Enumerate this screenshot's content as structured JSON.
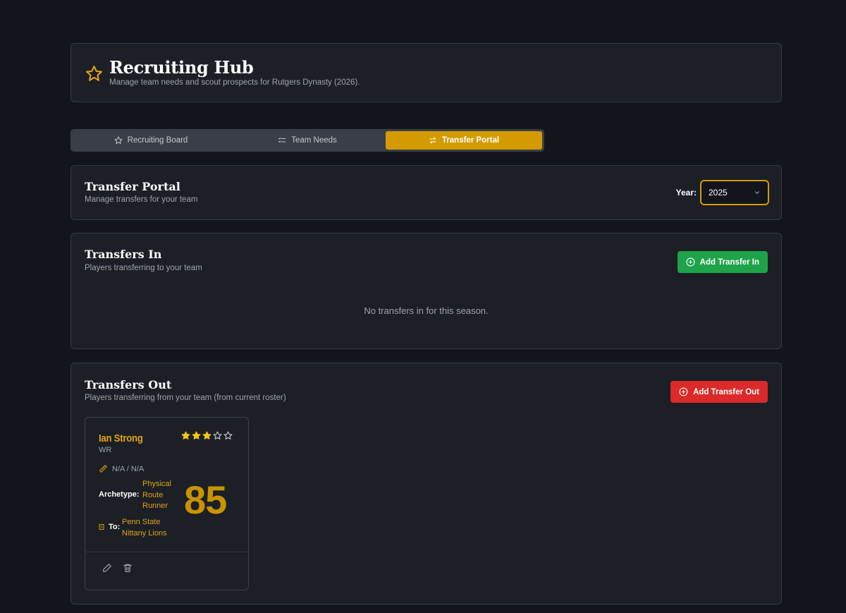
{
  "header": {
    "title": "Recruiting Hub",
    "subtitle": "Manage team needs and scout prospects for Rutgers Dynasty (2026).",
    "icon": "star-icon"
  },
  "tabs": [
    {
      "label": "Recruiting Board",
      "icon": "star-icon",
      "active": false
    },
    {
      "label": "Team Needs",
      "icon": "list-checks-icon",
      "active": false
    },
    {
      "label": "Transfer Portal",
      "icon": "arrows-swap-icon",
      "active": true
    }
  ],
  "portal": {
    "title": "Transfer Portal",
    "subtitle": "Manage transfers for your team",
    "year_label": "Year:",
    "year_value": "2025"
  },
  "transfers_in": {
    "title": "Transfers In",
    "subtitle": "Players transferring to your team",
    "add_label": "Add Transfer In",
    "empty_text": "No transfers in for this season."
  },
  "transfers_out": {
    "title": "Transfers Out",
    "subtitle": "Players transferring from your team (from current roster)",
    "add_label": "Add Transfer Out",
    "players": [
      {
        "name": "Ian Strong",
        "position": "WR",
        "stars": 3,
        "max_stars": 5,
        "height_weight": "N/A / N/A",
        "archetype_label": "Archetype:",
        "archetype": "Physical Route Runner",
        "to_label": "To:",
        "to_school": "Penn State Nittany Lions",
        "overall": "85"
      }
    ]
  },
  "colors": {
    "accent": "#d49b00",
    "green": "#1fa34a",
    "red": "#dc2a2a",
    "background": "#12151b",
    "card": "#1c1f25"
  }
}
